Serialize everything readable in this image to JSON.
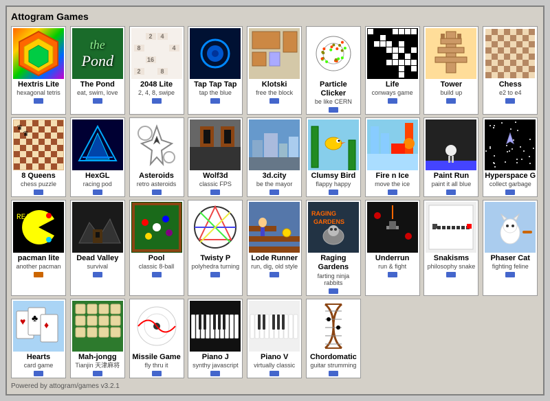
{
  "app": {
    "title": "Attogram Games",
    "footer": "Powered by attogram/games v3.2.1"
  },
  "games": [
    {
      "id": "hextris",
      "title": "Hextris Lite",
      "subtitle": "hexagonal tetris",
      "thumb": "hextris",
      "badge": "blue"
    },
    {
      "id": "pond",
      "title": "The Pond",
      "subtitle": "eat, swim, love",
      "thumb": "pond",
      "badge": "blue"
    },
    {
      "id": "2048",
      "title": "2048 Lite",
      "subtitle": "2, 4, 8, swipe",
      "thumb": "2048",
      "badge": "blue"
    },
    {
      "id": "taptap",
      "title": "Tap Tap Tap",
      "subtitle": "tap the blue",
      "thumb": "taptap",
      "badge": "blue"
    },
    {
      "id": "klotski",
      "title": "Klotski",
      "subtitle": "free the block",
      "thumb": "klotski",
      "badge": "blue"
    },
    {
      "id": "particle",
      "title": "Particle Clicker",
      "subtitle": "be like CERN",
      "thumb": "particle",
      "badge": "blue"
    },
    {
      "id": "life",
      "title": "Life",
      "subtitle": "conways game",
      "thumb": "life",
      "badge": "blue"
    },
    {
      "id": "tower",
      "title": "Tower",
      "subtitle": "build up",
      "thumb": "tower",
      "badge": "blue"
    },
    {
      "id": "chess",
      "title": "Chess",
      "subtitle": "e2 to e4",
      "thumb": "chess",
      "badge": "blue"
    },
    {
      "id": "8queens",
      "title": "8 Queens",
      "subtitle": "chess puzzle",
      "thumb": "8queens",
      "badge": "blue"
    },
    {
      "id": "hexgl",
      "title": "HexGL",
      "subtitle": "racing pod",
      "thumb": "hexgl",
      "badge": "blue"
    },
    {
      "id": "asteroids",
      "title": "Asteroids",
      "subtitle": "retro asteroids",
      "thumb": "asteroids",
      "badge": "blue"
    },
    {
      "id": "wolf3d",
      "title": "Wolf3d",
      "subtitle": "classic FPS",
      "thumb": "wolf3d",
      "badge": "blue"
    },
    {
      "id": "3dcity",
      "title": "3d.city",
      "subtitle": "be the mayor",
      "thumb": "3dcity",
      "badge": "blue"
    },
    {
      "id": "clumsybird",
      "title": "Clumsy Bird",
      "subtitle": "flappy happy",
      "thumb": "clumsy",
      "badge": "blue"
    },
    {
      "id": "firenice",
      "title": "Fire n Ice",
      "subtitle": "move the ice",
      "thumb": "firenice",
      "badge": "blue"
    },
    {
      "id": "paintrun",
      "title": "Paint Run",
      "subtitle": "paint it all blue",
      "thumb": "paintrun",
      "badge": "blue"
    },
    {
      "id": "hyperspace",
      "title": "Hyperspace G",
      "subtitle": "collect garbage",
      "thumb": "hyperspace",
      "badge": "blue"
    },
    {
      "id": "pacman",
      "title": "pacman lite",
      "subtitle": "another pacman",
      "thumb": "pacman",
      "badge": "orange"
    },
    {
      "id": "deadvalley",
      "title": "Dead Valley",
      "subtitle": "survival",
      "thumb": "deadvalley",
      "badge": "blue"
    },
    {
      "id": "pool",
      "title": "Pool",
      "subtitle": "classic 8-ball",
      "thumb": "pool",
      "badge": "blue"
    },
    {
      "id": "twistyp",
      "title": "Twisty P",
      "subtitle": "polyhedra turning",
      "thumb": "twistyp",
      "badge": "blue"
    },
    {
      "id": "loderunner",
      "title": "Lode Runner",
      "subtitle": "run, dig, old style",
      "thumb": "loderunner",
      "badge": "blue"
    },
    {
      "id": "raging",
      "title": "Raging Gardens",
      "subtitle": "farting ninja rabbits",
      "thumb": "raging",
      "badge": "blue"
    },
    {
      "id": "underrun",
      "title": "Underrun",
      "subtitle": "run & fight",
      "thumb": "underrun",
      "badge": "blue"
    },
    {
      "id": "snakisms",
      "title": "Snakisms",
      "subtitle": "philosophy snake",
      "thumb": "snakisms",
      "badge": "blue"
    },
    {
      "id": "phasercat",
      "title": "Phaser Cat",
      "subtitle": "fighting feline",
      "thumb": "phasercat",
      "badge": "blue"
    },
    {
      "id": "hearts",
      "title": "Hearts",
      "subtitle": "card game",
      "thumb": "hearts",
      "badge": "blue"
    },
    {
      "id": "mahjongg",
      "title": "Mah-jongg",
      "subtitle": "Tianjin 天津麻将",
      "thumb": "mahjongg",
      "badge": "blue"
    },
    {
      "id": "missile",
      "title": "Missile Game",
      "subtitle": "fly thru it",
      "thumb": "missile",
      "badge": "blue"
    },
    {
      "id": "pianoj",
      "title": "Piano J",
      "subtitle": "synthy javascript",
      "thumb": "pianoj",
      "badge": "blue"
    },
    {
      "id": "pianop",
      "title": "Piano V",
      "subtitle": "virtually classic",
      "thumb": "pianop",
      "badge": "blue"
    },
    {
      "id": "chordo",
      "title": "Chordomatic",
      "subtitle": "guitar strumming",
      "thumb": "chordo",
      "badge": "blue"
    }
  ]
}
